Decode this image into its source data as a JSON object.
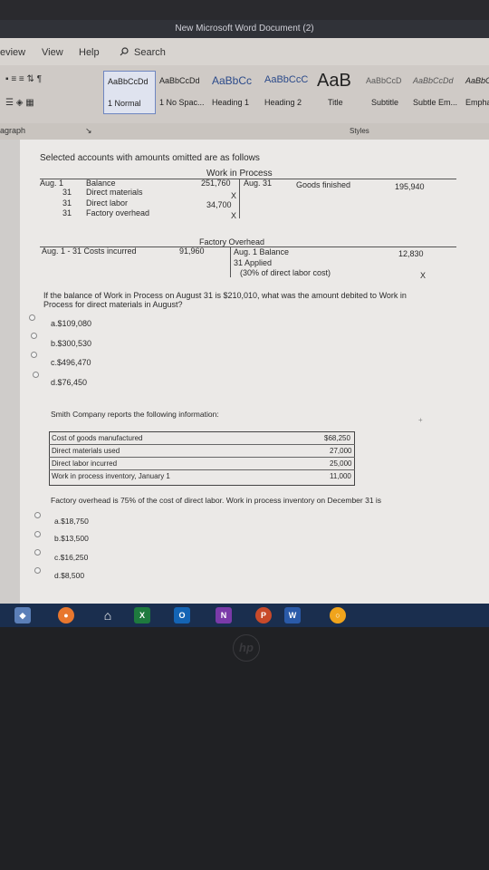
{
  "window": {
    "title": "New Microsoft Word Document (2)"
  },
  "menu": {
    "review": "eview",
    "view": "View",
    "help": "Help",
    "search": "Search"
  },
  "styles": [
    {
      "sample": "AaBbCcDd",
      "name": "1 Normal"
    },
    {
      "sample": "AaBbCcDd",
      "name": "1 No Spac..."
    },
    {
      "sample": "AaBbCc",
      "name": "Heading 1"
    },
    {
      "sample": "AaBbCcC",
      "name": "Heading 2"
    },
    {
      "sample": "AaB",
      "name": "Title"
    },
    {
      "sample": "AaBbCcD",
      "name": "Subtitle"
    },
    {
      "sample": "AaBbCcDd",
      "name": "Subtle Em..."
    },
    {
      "sample": "AaBbC",
      "name": "Empha"
    }
  ],
  "groups": {
    "paragraph": "agraph",
    "styles": "Styles"
  },
  "doc": {
    "intro": "Selected accounts with amounts omitted are as follows",
    "wip": {
      "title": "Work in Process",
      "aug1": "Aug. 1",
      "balance": "Balance",
      "balance_amt": "251,760",
      "aug31_right": "Aug. 31",
      "goods": "Goods finished",
      "goods_amt": "195,940",
      "d31a": "31",
      "dm": "Direct materials",
      "dm_amt": "X",
      "d31b": "31",
      "dl": "Direct labor",
      "dl_amt": "34,700",
      "d31c": "31",
      "fo": "Factory overhead",
      "fo_amt": "X"
    },
    "foh": {
      "title": "Factory Overhead",
      "left": "Aug. 1 - 31 Costs incurred",
      "left_amt": "91,960",
      "right1": "Aug. 1 Balance",
      "right1_amt": "12,830",
      "right2": "31 Applied",
      "right3": "(30% of direct labor cost)",
      "right3_amt": "X"
    },
    "q1": {
      "text1": "If the balance of Work in Process on August 31 is $210,010, what was the amount debited to Work in",
      "text2": "Process for direct materials in August?",
      "options": [
        "a.$109,080",
        "b.$300,530",
        "c.$496,470",
        "d.$76,450"
      ]
    },
    "q2": {
      "intro": "Smith Company reports the following information:",
      "rows": [
        {
          "label": "Cost of goods manufactured",
          "value": "$68,250"
        },
        {
          "label": "Direct materials used",
          "value": "27,000"
        },
        {
          "label": "Direct labor incurred",
          "value": "25,000"
        },
        {
          "label": "Work in process inventory, January 1",
          "value": "11,000"
        }
      ],
      "text": "Factory overhead is 75% of the cost of direct labor. Work in process inventory on December 31 is",
      "options": [
        "a.$18,750",
        "b.$13,500",
        "c.$16,250",
        "d.$8,500"
      ]
    }
  },
  "taskbar": {
    "excel": "X",
    "outlook": "O",
    "onenote": "N",
    "ppt": "P",
    "word": "W"
  },
  "bezel": {
    "logo": "hp"
  }
}
